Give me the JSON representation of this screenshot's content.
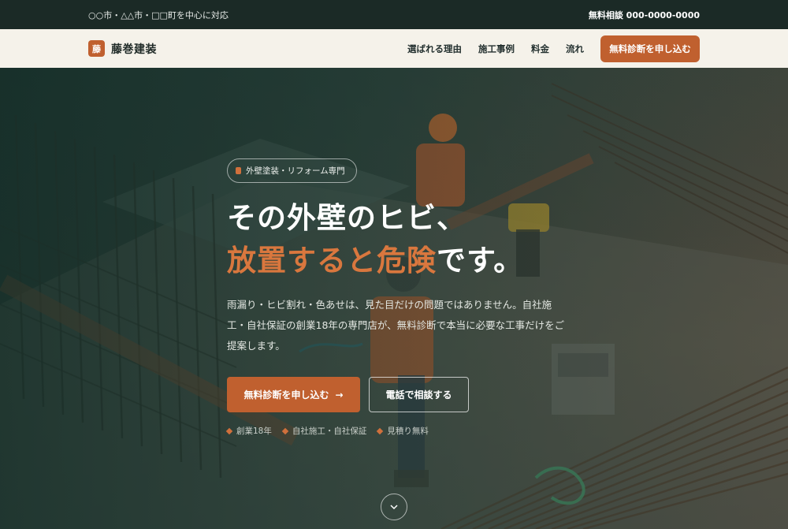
{
  "topbar": {
    "area_text": "○○市・△△市・□□町を中心に対応",
    "phone_text": "無料相談 000-0000-0000"
  },
  "navbar": {
    "logo_mark": "藤",
    "logo_text": "藤巻建装",
    "links": [
      "選ばれる理由",
      "施工事例",
      "料金",
      "流れ"
    ],
    "cta_label": "無料診断を申し込む"
  },
  "hero": {
    "tag": "外壁塗装・リフォーム専門",
    "headline_line1": "その外壁のヒビ、",
    "headline_accent": "放置すると危険",
    "headline_rest": "です。",
    "lead": "雨漏り・ヒビ割れ・色あせは、見た目だけの問題ではありません。自社施工・自社保証の創業18年の専門店が、無料診断で本当に必要な工事だけをご提案します。",
    "primary_button": "無料診断を申し込む",
    "primary_arrow": "→",
    "secondary_button": "電話で相談する",
    "badges": [
      "創業18年",
      "自社施工・自社保証",
      "見積り無料"
    ]
  },
  "colors": {
    "accent": "#c0602f",
    "dark": "#1b2a26",
    "nav_bg": "#f5f2ea"
  },
  "icons": {
    "logo": "logo-mark",
    "scroll": "chevron-down-icon",
    "arrow": "arrow-right-icon"
  }
}
